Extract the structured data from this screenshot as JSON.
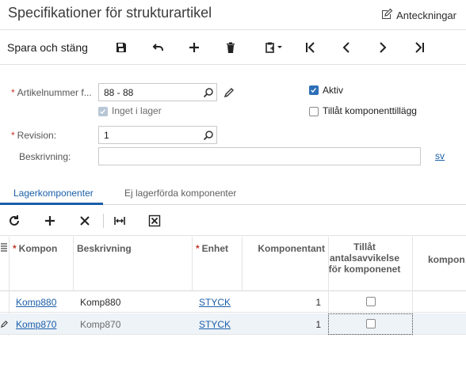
{
  "header": {
    "title": "Specifikationer för strukturartikel",
    "notes_label": "Anteckningar"
  },
  "toolbar": {
    "save_close_label": "Spara och stäng"
  },
  "form": {
    "item_number": {
      "label": "Artikelnummer f...",
      "value": "88 - 88",
      "required": true
    },
    "not_in_stock": {
      "label": "Inget i lager",
      "checked": true,
      "disabled": true
    },
    "revision": {
      "label": "Revision:",
      "value": "1",
      "required": true
    },
    "description": {
      "label": "Beskrivning:",
      "value": ""
    },
    "active": {
      "label": "Aktiv",
      "checked": true
    },
    "allow_component_additions": {
      "label": "Tillåt komponenttillägg",
      "checked": false
    },
    "language_link": "sv"
  },
  "tabs": [
    {
      "label": "Lagerkomponenter",
      "active": true
    },
    {
      "label": "Ej lagerförda komponenter",
      "active": false
    }
  ],
  "grid": {
    "columns": {
      "component": "Kompon",
      "description": "Beskrivning",
      "unit": "Enhet",
      "quantity": "Komponentant",
      "allow_deviation": "Tillåt antalsavvikelse för komponenet",
      "extra": "kompon"
    },
    "rows": [
      {
        "component": "Komp880",
        "description": "Komp880",
        "unit": "STYCK",
        "quantity": "1",
        "allow_deviation": false
      },
      {
        "component": "Komp870",
        "description": "Komp870",
        "unit": "STYCK",
        "quantity": "1",
        "allow_deviation": false
      }
    ]
  },
  "colors": {
    "accent": "#1a5ea8",
    "required": "#c0392b",
    "checkbox_checked": "#2d6fb7"
  }
}
